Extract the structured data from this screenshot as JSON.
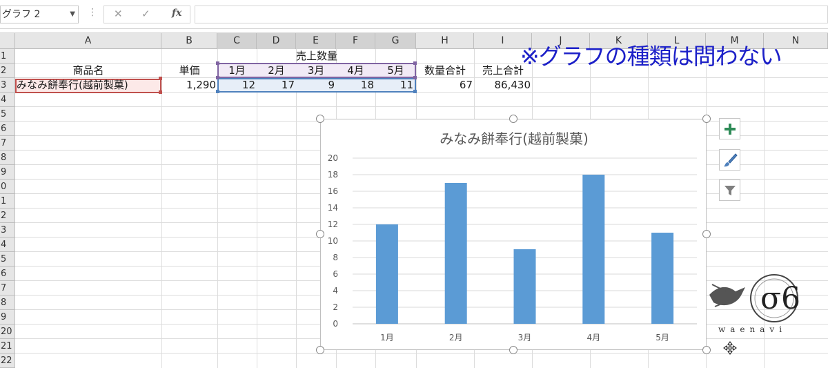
{
  "formula_bar": {
    "name_box": "グラフ 2",
    "name_box_dropdown": "▼",
    "separator": "⋮",
    "cancel_glyph": "✕",
    "enter_glyph": "✓",
    "fx_label": "fx",
    "formula_value": ""
  },
  "columns": [
    "A",
    "B",
    "C",
    "D",
    "E",
    "F",
    "G",
    "H",
    "I",
    "J",
    "K",
    "L",
    "M",
    "N"
  ],
  "rows": [
    "1",
    "2",
    "3",
    "4",
    "5",
    "6",
    "7",
    "8",
    "9",
    "0",
    "1",
    "2",
    "3",
    "4",
    "5",
    "6",
    "7",
    "8",
    "9",
    "20",
    "21",
    "22"
  ],
  "sheet": {
    "merged_header": "売上数量",
    "headers": {
      "product": "商品名",
      "unit_price": "単価",
      "qty_total": "数量合計",
      "sales_total": "売上合計"
    },
    "months": [
      "1月",
      "2月",
      "3月",
      "4月",
      "5月"
    ],
    "row3": {
      "product": "みなみ餅奉行(越前製菓)",
      "unit_price": "1,290",
      "quantities": [
        "12",
        "17",
        "9",
        "18",
        "11"
      ],
      "qty_total": "67",
      "sales_total": "86,430"
    }
  },
  "annotation": "※グラフの種類は問わない",
  "chart_data": {
    "type": "bar",
    "title": "みなみ餅奉行(越前製菓)",
    "categories": [
      "1月",
      "2月",
      "3月",
      "4月",
      "5月"
    ],
    "values": [
      12,
      17,
      9,
      18,
      11
    ],
    "ylim": [
      0,
      20
    ],
    "y_ticks": [
      "0",
      "2",
      "4",
      "6",
      "8",
      "10",
      "12",
      "14",
      "16",
      "18",
      "20"
    ],
    "grid": true,
    "bar_color": "#5b9bd5"
  },
  "chart_tools": {
    "add_element_icon": "plus-icon",
    "style_icon": "brush-icon",
    "filter_icon": "filter-icon"
  },
  "watermark": {
    "text": "waenavi"
  },
  "colors": {
    "annotation": "#1c20c8",
    "sel_product": "#c0504d",
    "sel_header": "#8064a2",
    "sel_values": "#4f81bd"
  }
}
